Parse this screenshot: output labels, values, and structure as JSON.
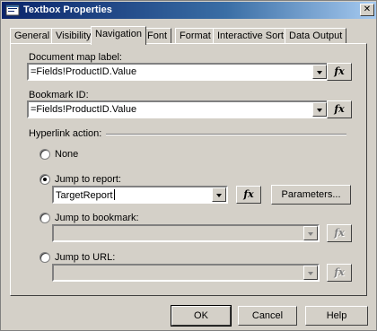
{
  "window": {
    "title": "Textbox Properties",
    "close_glyph": "✕"
  },
  "tabs": [
    {
      "label": "General",
      "active": false
    },
    {
      "label": "Visibility",
      "active": false
    },
    {
      "label": "Navigation",
      "active": true
    },
    {
      "label": "Font",
      "active": false
    },
    {
      "label": "Format",
      "active": false
    },
    {
      "label": "Interactive Sort",
      "active": false
    },
    {
      "label": "Data Output",
      "active": false
    }
  ],
  "document_map": {
    "label": "Document map label:",
    "value": "=Fields!ProductID.Value"
  },
  "bookmark": {
    "label": "Bookmark ID:",
    "value": "=Fields!ProductID.Value"
  },
  "hyperlink": {
    "label": "Hyperlink action:",
    "none_label": "None",
    "jump_report_label": "Jump to report:",
    "jump_report_value": "TargetReport",
    "parameters_label": "Parameters...",
    "jump_bookmark_label": "Jump to bookmark:",
    "jump_bookmark_value": "",
    "jump_url_label": "Jump to URL:",
    "jump_url_value": "",
    "selected": "jump_report"
  },
  "fx_label": "fx",
  "buttons": {
    "ok": "OK",
    "cancel": "Cancel",
    "help": "Help"
  }
}
